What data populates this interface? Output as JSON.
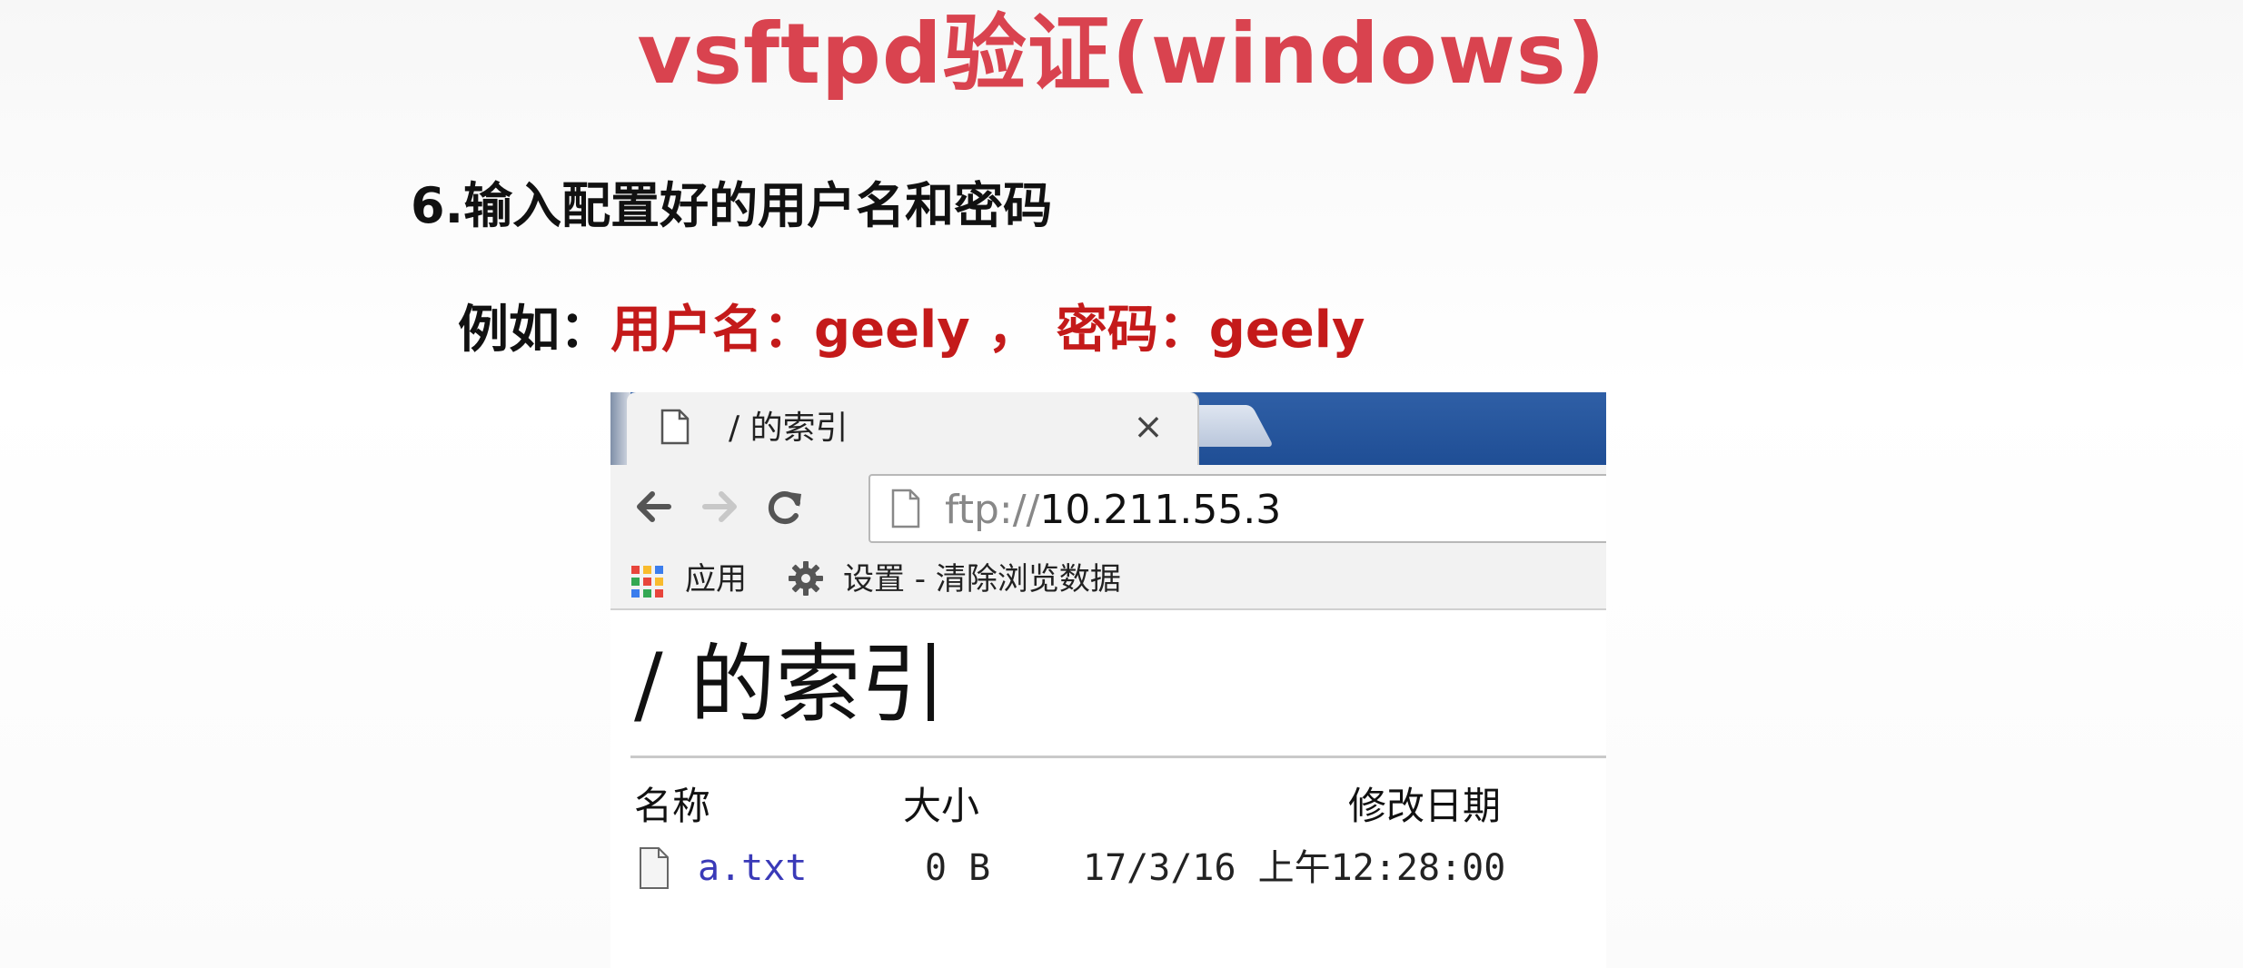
{
  "slide": {
    "title": "vsftpd验证(windows)",
    "step": "6.输入配置好的用户名和密码",
    "example_prefix": "例如：",
    "example_user": "用户名：geely",
    "example_sep": " ， ",
    "example_pass": "密码：geely"
  },
  "browser": {
    "tab": {
      "title": "/ 的索引",
      "icon": "page-icon",
      "close": "×"
    },
    "toolbar": {
      "back_icon": "back-arrow-icon",
      "forward_icon": "forward-arrow-icon",
      "reload_icon": "reload-icon",
      "url_scheme": "ftp://",
      "url_host": "10.211.55.3"
    },
    "bookmarks": [
      {
        "label": "应用",
        "icon": "apps-grid-icon"
      },
      {
        "label": "设置 - 清除浏览数据",
        "icon": "gear-icon"
      }
    ],
    "page": {
      "heading": "/ 的索引",
      "columns": {
        "name": "名称",
        "size": "大小",
        "date": "修改日期"
      },
      "files": [
        {
          "name": "a.txt",
          "size": "0 B",
          "date": "17/3/16 上午12:28:00"
        }
      ]
    }
  },
  "colors": {
    "title_red": "#d9434f",
    "highlight_red": "#c41a1a",
    "tabstrip_blue": "#2f5fa6",
    "link_blue": "#3a3ab8"
  }
}
